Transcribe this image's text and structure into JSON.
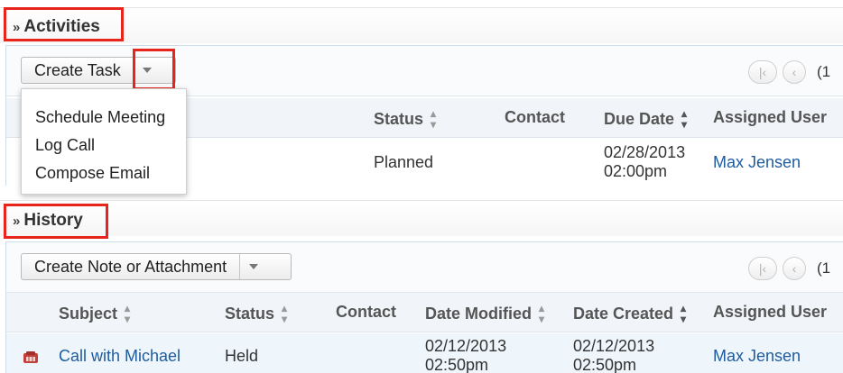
{
  "activities": {
    "title": "Activities",
    "create_button": "Create Task",
    "dropdown_items": [
      "Schedule Meeting",
      "Log Call",
      "Compose Email"
    ],
    "pager_text": "(1",
    "columns": [
      "Status",
      "Contact",
      "Due Date",
      "Assigned User"
    ],
    "rows": [
      {
        "status": "Planned",
        "contact": "",
        "due_date_line1": "02/28/2013",
        "due_date_line2": "02:00pm",
        "assigned_user": "Max Jensen"
      }
    ]
  },
  "history": {
    "title": "History",
    "create_button": "Create Note or Attachment",
    "pager_text": "(1",
    "columns": [
      "Subject",
      "Status",
      "Contact",
      "Date Modified",
      "Date Created",
      "Assigned User"
    ],
    "rows": [
      {
        "icon": "phone-call-icon",
        "subject": "Call with Michael",
        "status": "Held",
        "contact": "",
        "date_modified_line1": "02/12/2013",
        "date_modified_line2": "02:50pm",
        "date_created_line1": "02/12/2013",
        "date_created_line2": "02:50pm",
        "assigned_user": "Max Jensen"
      }
    ]
  },
  "icons": {
    "collapse": "double-chevron-up-icon",
    "first_page": "first-page-icon",
    "prev_page": "previous-page-icon",
    "sort": "sort-arrows-icon"
  },
  "colors": {
    "highlight_box": "#e8251c",
    "link": "#1e5b9e",
    "header_bg": "#f1f4f8",
    "row_alt_bg": "#eef6fc"
  }
}
